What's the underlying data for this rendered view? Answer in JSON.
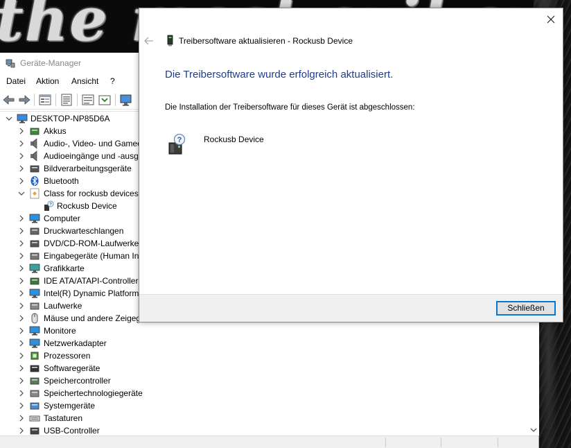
{
  "wallpaper": {
    "text": "the most evil ever dead"
  },
  "device_manager": {
    "title": "Geräte-Manager",
    "menu": [
      "Datei",
      "Aktion",
      "Ansicht",
      "?"
    ],
    "tree": {
      "root": "DESKTOP-NP85D6A",
      "items": [
        {
          "label": "Akkus",
          "icon": "battery-icon",
          "expanded": false
        },
        {
          "label": "Audio-, Video- und Gamecontroller",
          "icon": "speaker-icon",
          "expanded": false
        },
        {
          "label": "Audioeingänge und -ausgänge",
          "icon": "speaker-icon",
          "expanded": false
        },
        {
          "label": "Bildverarbeitungsgeräte",
          "icon": "camera-icon",
          "expanded": false
        },
        {
          "label": "Bluetooth",
          "icon": "bluetooth-icon",
          "expanded": false
        },
        {
          "label": "Class for rockusb devices",
          "icon": "class-icon",
          "expanded": true
        },
        {
          "label": "Rockusb Device",
          "icon": "unknown-device-icon",
          "child": true
        },
        {
          "label": "Computer",
          "icon": "monitor-icon",
          "expanded": false
        },
        {
          "label": "Druckwarteschlangen",
          "icon": "printer-icon",
          "expanded": false
        },
        {
          "label": "DVD/CD-ROM-Laufwerke",
          "icon": "dvd-icon",
          "expanded": false
        },
        {
          "label": "Eingabegeräte (Human Interface Devices)",
          "icon": "hid-icon",
          "expanded": false
        },
        {
          "label": "Grafikkarte",
          "icon": "display-adapter-icon",
          "expanded": false
        },
        {
          "label": "IDE ATA/ATAPI-Controller",
          "icon": "ide-icon",
          "expanded": false
        },
        {
          "label": "Intel(R) Dynamic Platform and Thermal Framework",
          "icon": "intel-icon",
          "expanded": false
        },
        {
          "label": "Laufwerke",
          "icon": "drive-icon",
          "expanded": false
        },
        {
          "label": "Mäuse und andere Zeigegeräte",
          "icon": "mouse-icon",
          "expanded": false
        },
        {
          "label": "Monitore",
          "icon": "monitor-icon",
          "expanded": false
        },
        {
          "label": "Netzwerkadapter",
          "icon": "network-icon",
          "expanded": false
        },
        {
          "label": "Prozessoren",
          "icon": "cpu-icon",
          "expanded": false
        },
        {
          "label": "Softwaregeräte",
          "icon": "software-device-icon",
          "expanded": false
        },
        {
          "label": "Speichercontroller",
          "icon": "storage-controller-icon",
          "expanded": false
        },
        {
          "label": "Speichertechnologiegeräte",
          "icon": "memory-tech-icon",
          "expanded": false
        },
        {
          "label": "Systemgeräte",
          "icon": "system-icon",
          "expanded": false
        },
        {
          "label": "Tastaturen",
          "icon": "keyboard-icon",
          "expanded": false
        },
        {
          "label": "USB-Controller",
          "icon": "usb-icon",
          "expanded": false
        }
      ]
    }
  },
  "dialog": {
    "title": "Treibersoftware aktualisieren - Rockusb Device",
    "heading": "Die Treibersoftware wurde erfolgreich aktualisiert.",
    "description": "Die Installation der Treibersoftware für dieses Gerät ist abgeschlossen:",
    "device_name": "Rockusb Device",
    "close_button": "Schließen"
  },
  "colors": {
    "heading": "#1e3c8c",
    "accent": "#0078d7",
    "footer": "#f0f0f0"
  }
}
